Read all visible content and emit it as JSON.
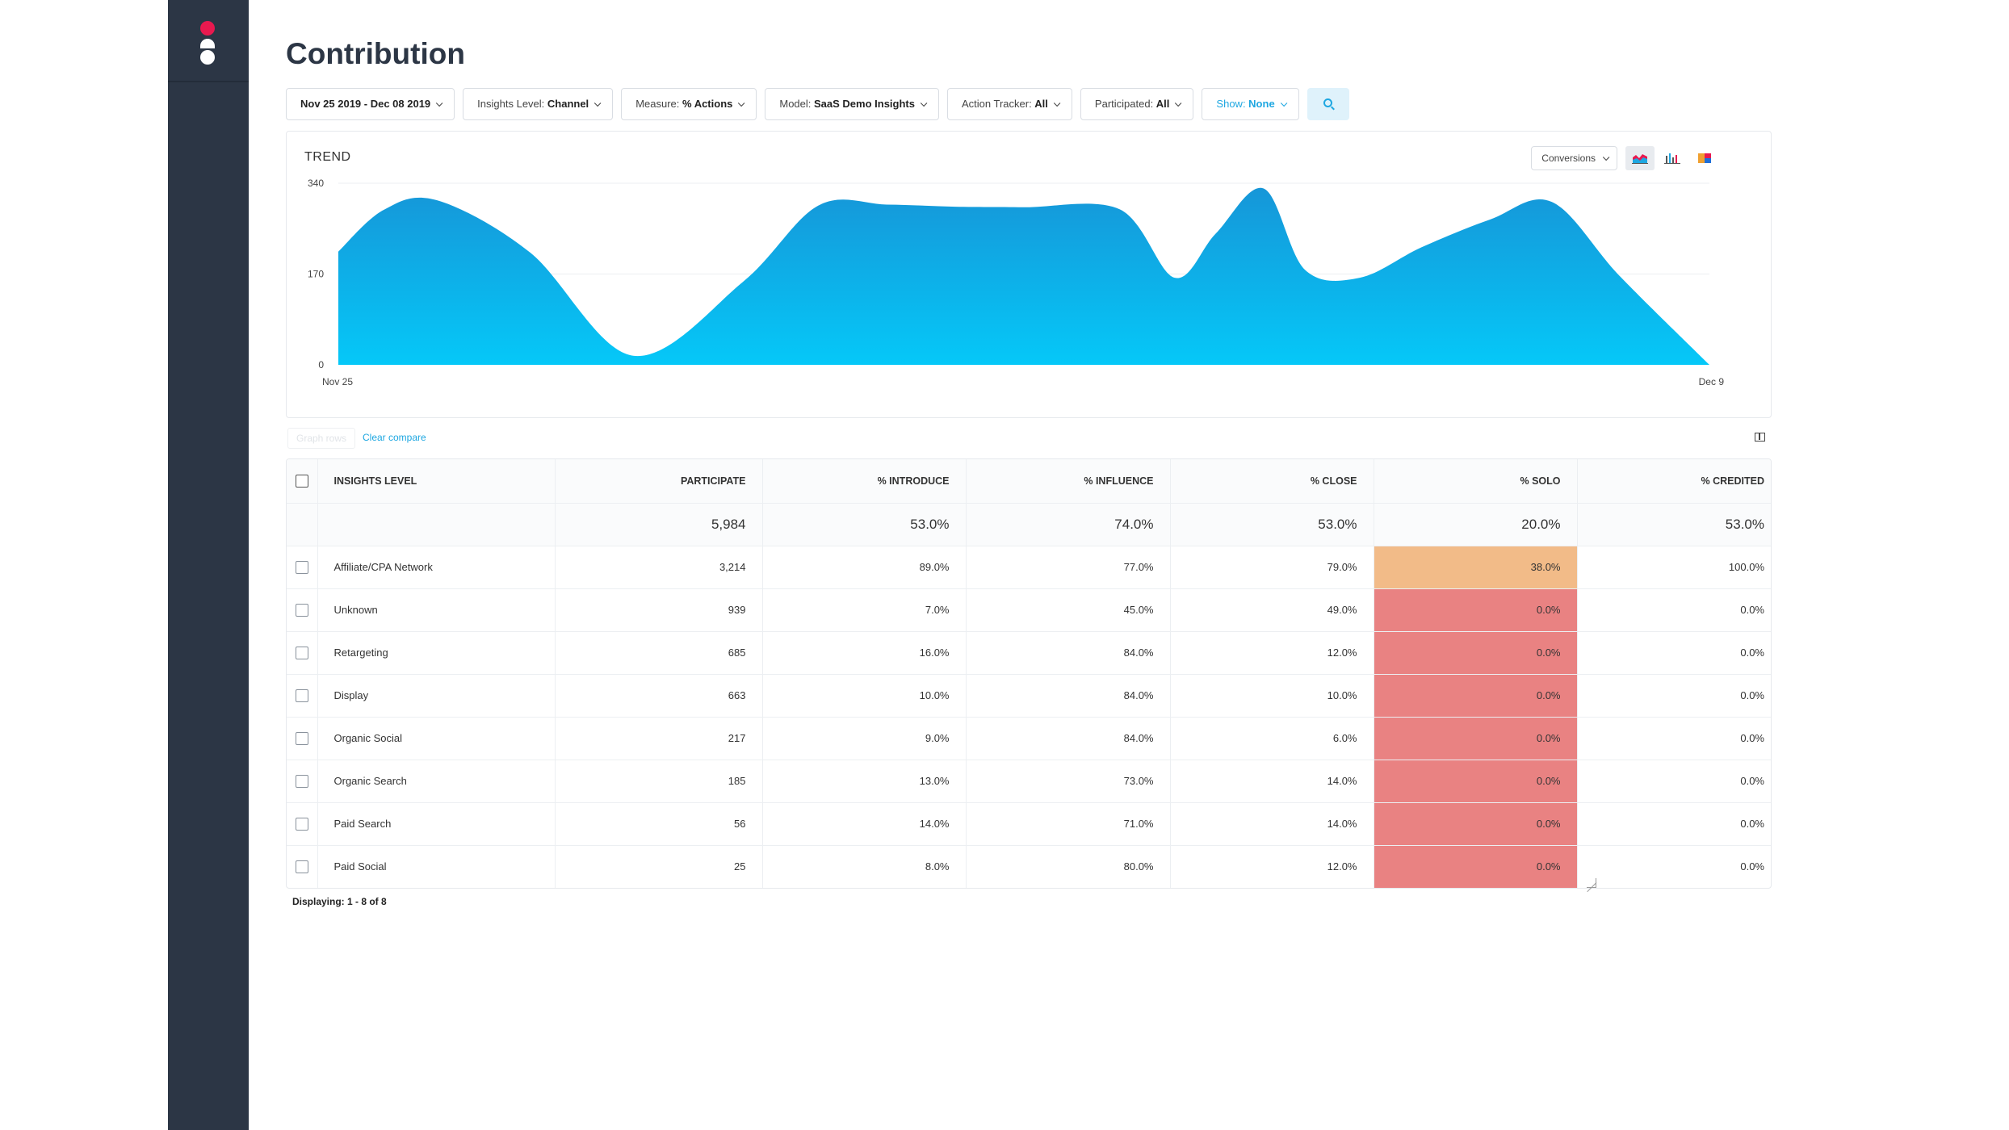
{
  "page": {
    "title": "Contribution"
  },
  "sidebar": {
    "logo_icon": "app-logo-icon"
  },
  "filters": [
    {
      "label": "",
      "value": "Nov 25 2019 - Dec 08 2019",
      "name": "date-range-filter"
    },
    {
      "label": "Insights Level: ",
      "value": "Channel",
      "name": "insights-level-filter"
    },
    {
      "label": "Measure: ",
      "value": "% Actions",
      "name": "measure-filter"
    },
    {
      "label": "Model: ",
      "value": "SaaS Demo Insights",
      "name": "model-filter"
    },
    {
      "label": "Action Tracker: ",
      "value": "All",
      "name": "action-tracker-filter"
    },
    {
      "label": "Participated: ",
      "value": "All",
      "name": "participated-filter"
    },
    {
      "label": "Show: ",
      "value": "None",
      "name": "show-filter"
    }
  ],
  "trend": {
    "title": "TREND",
    "metric_select": "Conversions",
    "chart_types": [
      "area-chart-icon",
      "bar-chart-icon",
      "stacked-chart-icon"
    ]
  },
  "chart_data": {
    "type": "area",
    "x_labels": [
      "Nov 25",
      "Dec 9"
    ],
    "y_ticks": [
      0,
      170,
      340
    ],
    "ylim": [
      0,
      340
    ],
    "x": [
      0,
      0.033,
      0.072,
      0.14,
      0.215,
      0.295,
      0.35,
      0.4,
      0.45,
      0.5,
      0.57,
      0.61,
      0.64,
      0.675,
      0.705,
      0.745,
      0.79,
      0.84,
      0.885,
      0.935,
      1.0
    ],
    "values": [
      212,
      290,
      308,
      210,
      17,
      155,
      298,
      300,
      296,
      295,
      291,
      163,
      246,
      330,
      178,
      163,
      220,
      272,
      305,
      165,
      0
    ],
    "colors": {
      "top": "#1696d8",
      "bottom": "#05c8f8"
    },
    "grid": true
  },
  "toolbar": {
    "disabled_button": "Graph rows",
    "clear_compare": "Clear compare",
    "columns_icon": "columns-icon"
  },
  "table": {
    "headers": [
      "INSIGHTS LEVEL",
      "PARTICIPATE",
      "% INTRODUCE",
      "% INFLUENCE",
      "% CLOSE",
      "% SOLO",
      "% CREDITED"
    ],
    "summary": [
      "",
      "5,984",
      "53.0%",
      "74.0%",
      "53.0%",
      "20.0%",
      "53.0%"
    ],
    "rows": [
      [
        "Affiliate/CPA Network",
        "3,214",
        "89.0%",
        "77.0%",
        "79.0%",
        "38.0%",
        "100.0%"
      ],
      [
        "Unknown",
        "939",
        "7.0%",
        "45.0%",
        "49.0%",
        "0.0%",
        "0.0%"
      ],
      [
        "Retargeting",
        "685",
        "16.0%",
        "84.0%",
        "12.0%",
        "0.0%",
        "0.0%"
      ],
      [
        "Display",
        "663",
        "10.0%",
        "84.0%",
        "10.0%",
        "0.0%",
        "0.0%"
      ],
      [
        "Organic Social",
        "217",
        "9.0%",
        "84.0%",
        "6.0%",
        "0.0%",
        "0.0%"
      ],
      [
        "Organic Search",
        "185",
        "13.0%",
        "73.0%",
        "14.0%",
        "0.0%",
        "0.0%"
      ],
      [
        "Paid Search",
        "56",
        "14.0%",
        "71.0%",
        "14.0%",
        "0.0%",
        "0.0%"
      ],
      [
        "Paid Social",
        "25",
        "8.0%",
        "80.0%",
        "12.0%",
        "0.0%",
        "0.0%"
      ]
    ],
    "highlight_colors": {
      "orange": "#f2bb88",
      "red": "#e98282"
    }
  },
  "footer": {
    "displaying": "Displaying: 1 - 8 of 8"
  }
}
